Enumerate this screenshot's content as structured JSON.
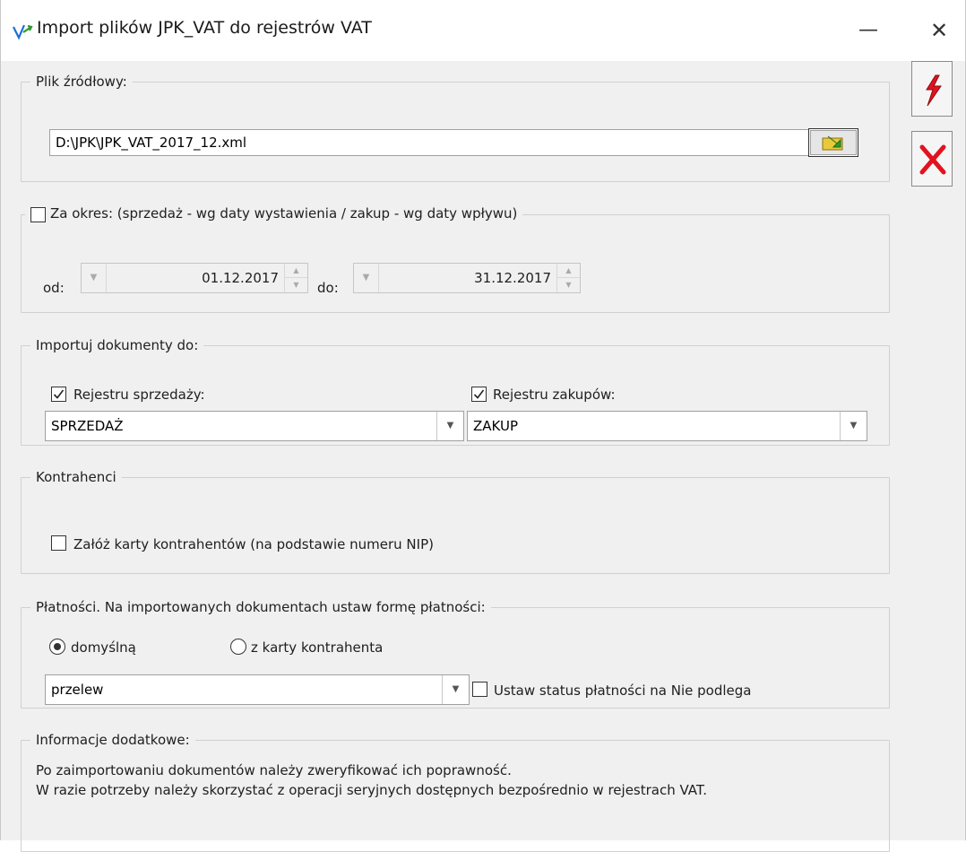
{
  "window": {
    "title": "Import plików JPK_VAT do rejestrów VAT",
    "minimize_glyph": "—",
    "close_glyph": "✕",
    "side_buttons": {
      "confirm_icon": "lightning-icon",
      "cancel_icon": "red-x-icon",
      "colors": {
        "lightning": "#e0141e",
        "x": "#e0141e"
      }
    }
  },
  "source_file": {
    "legend": "Plik źródłowy:",
    "path_value": "D:\\JPK\\JPK_VAT_2017_12.xml",
    "browse_icon": "folder-browse-icon"
  },
  "period": {
    "checkbox_label": "Za okres: (sprzedaż - wg daty wystawienia / zakup - wg daty wpływu)",
    "checked": false,
    "from_label": "od:",
    "from_value": "01.12.2017",
    "to_label": "do:",
    "to_value": "31.12.2017"
  },
  "import_to": {
    "legend": "Importuj dokumenty do:",
    "sales_label": "Rejestru sprzedaży:",
    "sales_checked": true,
    "sales_value": "SPRZEDAŻ",
    "purchase_label": "Rejestru zakupów:",
    "purchase_checked": true,
    "purchase_value": "ZAKUP"
  },
  "contractors": {
    "legend": "Kontrahenci",
    "create_cards_label": "Załóż karty kontrahentów (na podstawie numeru NIP)",
    "create_cards_checked": false
  },
  "payments": {
    "legend": "Płatności. Na importowanych dokumentach ustaw formę płatności:",
    "radio_default_label": "domyślną",
    "radio_default_selected": true,
    "radio_card_label": "z karty kontrahenta",
    "radio_card_selected": false,
    "method_value": "przelew",
    "not_applicable_label": "Ustaw status płatności na Nie podlega",
    "not_applicable_checked": false
  },
  "additional_info": {
    "legend": "Informacje dodatkowe:",
    "line1": "Po zaimportowaniu dokumentów należy zweryfikować ich poprawność.",
    "line2": "W razie potrzeby należy skorzystać z operacji seryjnych dostępnych bezpośrednio w rejestrach VAT."
  }
}
